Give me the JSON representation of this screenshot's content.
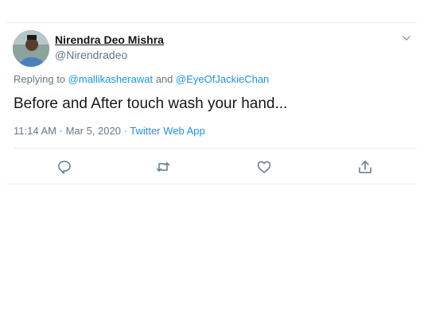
{
  "tweet": {
    "author_name": "Nirendra Deo Mishra",
    "author_handle": "@Nirendradeo",
    "replying_prefix": "Replying to",
    "mention_1": "@mallikasherawat",
    "and_word": "and",
    "mention_2": "@EyeOfJackieChan",
    "text": "Before and After touch wash your hand...",
    "time": "11:14 AM",
    "separator": "·",
    "date": "Mar 5, 2020",
    "source": "Twitter Web App"
  },
  "actions": [
    "reply-icon",
    "retweet-icon",
    "like-icon",
    "share-icon"
  ],
  "colors": {
    "link": "#1b95e0",
    "secondary_text": "#657786",
    "primary_text": "#14171a",
    "border": "#e6ecf0"
  }
}
